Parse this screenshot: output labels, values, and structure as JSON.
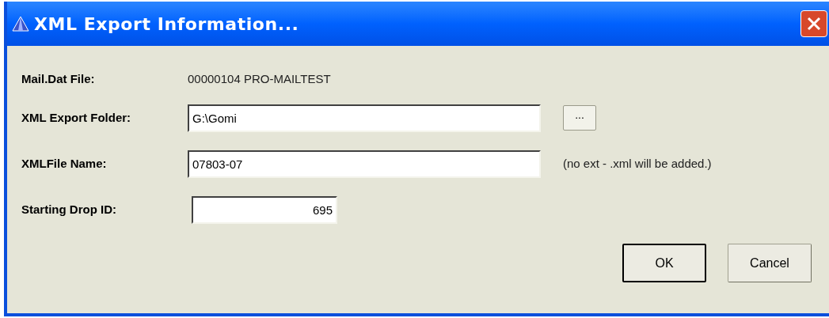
{
  "window": {
    "title": "XML Export Information..."
  },
  "rows": [
    {
      "kind": "text",
      "label": "Mail.Dat File:",
      "value": "00000104 PRO-MAILTEST"
    },
    {
      "kind": "folder",
      "label": "XML Export Folder:",
      "value": "G:\\Gomi",
      "browse": "..."
    },
    {
      "kind": "file",
      "label": "XMLFile Name:",
      "value": "07803-07",
      "note": "(no ext - .xml will be added.)"
    },
    {
      "kind": "number",
      "label": "Starting Drop ID:",
      "value": "695"
    }
  ],
  "buttons": [
    {
      "label": "OK",
      "default": true
    },
    {
      "label": "Cancel",
      "default": false
    }
  ]
}
